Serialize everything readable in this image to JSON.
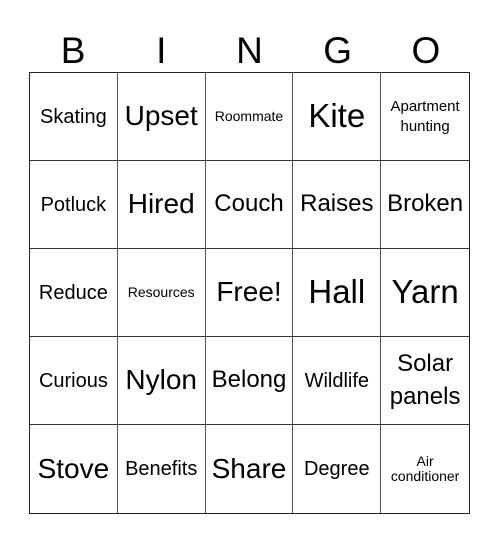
{
  "header": {
    "letters": [
      "B",
      "I",
      "N",
      "G",
      "O"
    ]
  },
  "rows": [
    [
      "Skating",
      "Upset",
      "Roommate",
      "Kite",
      "Apartment hunting"
    ],
    [
      "Potluck",
      "Hired",
      "Couch",
      "Raises",
      "Broken"
    ],
    [
      "Reduce",
      "Resources",
      "Free!",
      "Hall",
      "Yarn"
    ],
    [
      "Curious",
      "Nylon",
      "Belong",
      "Wildlife",
      "Solar panels"
    ],
    [
      "Stove",
      "Benefits",
      "Share",
      "Degree",
      "Air conditioner"
    ]
  ]
}
